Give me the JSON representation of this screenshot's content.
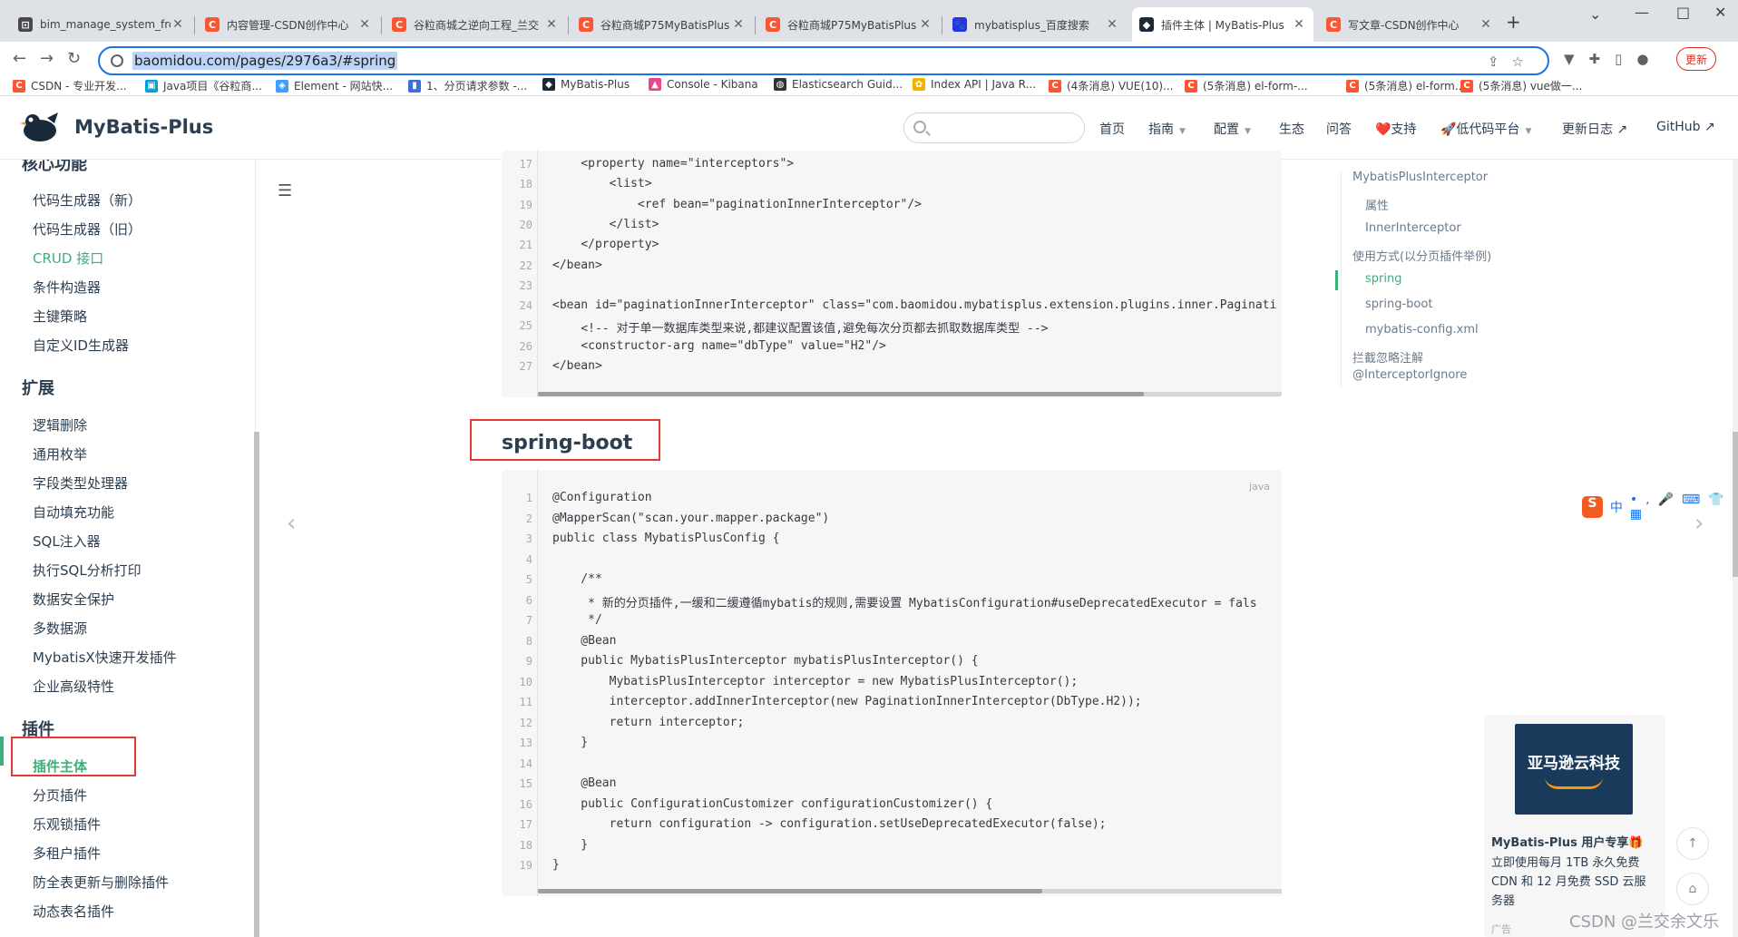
{
  "browser": {
    "tabs": [
      {
        "title": "bim_manage_system_fro",
        "icon": "#4a4a4a",
        "glyph": "⊡"
      },
      {
        "title": "内容管理-CSDN创作中心",
        "icon": "#fc5531",
        "glyph": "C"
      },
      {
        "title": "谷粒商城之逆向工程_兰交",
        "icon": "#fc5531",
        "glyph": "C"
      },
      {
        "title": "谷粒商城P75MyBatisPlus",
        "icon": "#fc5531",
        "glyph": "C"
      },
      {
        "title": "谷粒商城P75MyBatisPlus",
        "icon": "#fc5531",
        "glyph": "C"
      },
      {
        "title": "mybatisplus_百度搜索",
        "icon": "#2932e1",
        "glyph": "🐾"
      },
      {
        "title": "插件主体 | MyBatis-Plus",
        "icon": "#1a2a3a",
        "glyph": "◆"
      },
      {
        "title": "写文章-CSDN创作中心",
        "icon": "#fc5531",
        "glyph": "C"
      }
    ],
    "active_tab": 6,
    "url": "baomidou.com/pages/2976a3/#spring",
    "update_label": "更新",
    "bookmarks": [
      {
        "label": "CSDN - 专业开发...",
        "color": "#fc5531",
        "glyph": "C"
      },
      {
        "label": "Java项目《谷粒商...",
        "color": "#00a1d6",
        "glyph": "▣"
      },
      {
        "label": "Element - 网站快...",
        "color": "#409eff",
        "glyph": "◈"
      },
      {
        "label": "1、分页请求参数 -...",
        "color": "#3b6fd9",
        "glyph": "▮"
      },
      {
        "label": "MyBatis-Plus",
        "color": "#1a2a3a",
        "glyph": "◆"
      },
      {
        "label": "Console - Kibana",
        "color": "#e8478b",
        "glyph": "▲"
      },
      {
        "label": "Elasticsearch Guid...",
        "color": "#333333",
        "glyph": "◍"
      },
      {
        "label": "Index API | Java R...",
        "color": "#f0b400",
        "glyph": "✿"
      },
      {
        "label": "(4条消息) VUE(10)...",
        "color": "#fc5531",
        "glyph": "C"
      },
      {
        "label": "(5条消息) el-form-...",
        "color": "#fc5531",
        "glyph": "C"
      },
      {
        "label": "(5条消息) el-form...",
        "color": "#fc5531",
        "glyph": "C"
      },
      {
        "label": "(5条消息) vue做一...",
        "color": "#fc5531",
        "glyph": "C"
      }
    ]
  },
  "site": {
    "title": "MyBatis-Plus",
    "nav": [
      {
        "label": "首页",
        "dropdown": false
      },
      {
        "label": "指南",
        "dropdown": true
      },
      {
        "label": "配置",
        "dropdown": true
      },
      {
        "label": "生态",
        "dropdown": false
      },
      {
        "label": "问答",
        "dropdown": false
      },
      {
        "label": "❤️支持",
        "dropdown": false
      },
      {
        "label": "🚀低代码平台",
        "dropdown": true
      },
      {
        "label": "更新日志 ↗",
        "dropdown": false
      },
      {
        "label": "GitHub ↗",
        "dropdown": false
      }
    ]
  },
  "sidebar": {
    "groups": [
      {
        "title": "核心功能",
        "items": [
          {
            "label": "代码生成器（新）"
          },
          {
            "label": "代码生成器（旧）"
          },
          {
            "label": "CRUD 接口",
            "link": true
          },
          {
            "label": "条件构造器"
          },
          {
            "label": "主键策略"
          },
          {
            "label": "自定义ID生成器"
          }
        ]
      },
      {
        "title": "扩展",
        "items": [
          {
            "label": "逻辑删除"
          },
          {
            "label": "通用枚举"
          },
          {
            "label": "字段类型处理器"
          },
          {
            "label": "自动填充功能"
          },
          {
            "label": "SQL注入器"
          },
          {
            "label": "执行SQL分析打印"
          },
          {
            "label": "数据安全保护"
          },
          {
            "label": "多数据源"
          },
          {
            "label": "MybatisX快速开发插件"
          },
          {
            "label": "企业高级特性"
          }
        ]
      },
      {
        "title": "插件",
        "items": [
          {
            "label": "插件主体",
            "active": true
          },
          {
            "label": "分页插件"
          },
          {
            "label": "乐观锁插件"
          },
          {
            "label": "多租户插件"
          },
          {
            "label": "防全表更新与删除插件"
          },
          {
            "label": "动态表名插件"
          }
        ]
      }
    ]
  },
  "content": {
    "heading": "spring-boot",
    "lang_label": "java",
    "xml_code": [
      {
        "n": "17",
        "t": "    <property name=\"interceptors\">"
      },
      {
        "n": "18",
        "t": "        <list>"
      },
      {
        "n": "19",
        "t": "            <ref bean=\"paginationInnerInterceptor\"/>"
      },
      {
        "n": "20",
        "t": "        </list>"
      },
      {
        "n": "21",
        "t": "    </property>"
      },
      {
        "n": "22",
        "t": "</bean>"
      },
      {
        "n": "23",
        "t": ""
      },
      {
        "n": "24",
        "t": "<bean id=\"paginationInnerInterceptor\" class=\"com.baomidou.mybatisplus.extension.plugins.inner.Paginati"
      },
      {
        "n": "25",
        "t": "    <!-- 对于单一数据库类型来说,都建议配置该值,避免每次分页都去抓取数据库类型 -->"
      },
      {
        "n": "26",
        "t": "    <constructor-arg name=\"dbType\" value=\"H2\"/>"
      },
      {
        "n": "27",
        "t": "</bean>"
      }
    ],
    "java_code": [
      {
        "n": "1",
        "t": "@Configuration"
      },
      {
        "n": "2",
        "t": "@MapperScan(\"scan.your.mapper.package\")"
      },
      {
        "n": "3",
        "t": "public class MybatisPlusConfig {"
      },
      {
        "n": "4",
        "t": ""
      },
      {
        "n": "5",
        "t": "    /**"
      },
      {
        "n": "6",
        "t": "     * 新的分页插件,一缓和二缓遵循mybatis的规则,需要设置 MybatisConfiguration#useDeprecatedExecutor = fals"
      },
      {
        "n": "7",
        "t": "     */"
      },
      {
        "n": "8",
        "t": "    @Bean"
      },
      {
        "n": "9",
        "t": "    public MybatisPlusInterceptor mybatisPlusInterceptor() {"
      },
      {
        "n": "10",
        "t": "        MybatisPlusInterceptor interceptor = new MybatisPlusInterceptor();"
      },
      {
        "n": "11",
        "t": "        interceptor.addInnerInterceptor(new PaginationInnerInterceptor(DbType.H2));"
      },
      {
        "n": "12",
        "t": "        return interceptor;"
      },
      {
        "n": "13",
        "t": "    }"
      },
      {
        "n": "14",
        "t": ""
      },
      {
        "n": "15",
        "t": "    @Bean"
      },
      {
        "n": "16",
        "t": "    public ConfigurationCustomizer configurationCustomizer() {"
      },
      {
        "n": "17",
        "t": "        return configuration -> configuration.setUseDeprecatedExecutor(false);"
      },
      {
        "n": "18",
        "t": "    }"
      },
      {
        "n": "19",
        "t": "}"
      }
    ],
    "next_heading_fragment": "mybatis-config.xml"
  },
  "toc": [
    {
      "label": "MybatisPlusInterceptor",
      "level": 1
    },
    {
      "label": "属性",
      "level": 2
    },
    {
      "label": "InnerInterceptor",
      "level": 2
    },
    {
      "label": "使用方式(以分页插件举例)",
      "level": 1
    },
    {
      "label": "spring",
      "level": 2,
      "active": true
    },
    {
      "label": "spring-boot",
      "level": 2
    },
    {
      "label": "mybatis-config.xml",
      "level": 2
    },
    {
      "label": "拦截忽略注解",
      "level": 1
    },
    {
      "label": "@InterceptorIgnore",
      "level": 1
    }
  ],
  "ime": {
    "label": "中"
  },
  "ad": {
    "brand": "亚马逊云科技",
    "title": "MyBatis-Plus 用户专享🎁",
    "lines": [
      "立即使用每月 1TB 永久免费",
      "CDN 和 12 月免费 SSD 云服",
      "务器"
    ],
    "tag": "广告"
  },
  "watermark": "CSDN @兰交余文乐"
}
